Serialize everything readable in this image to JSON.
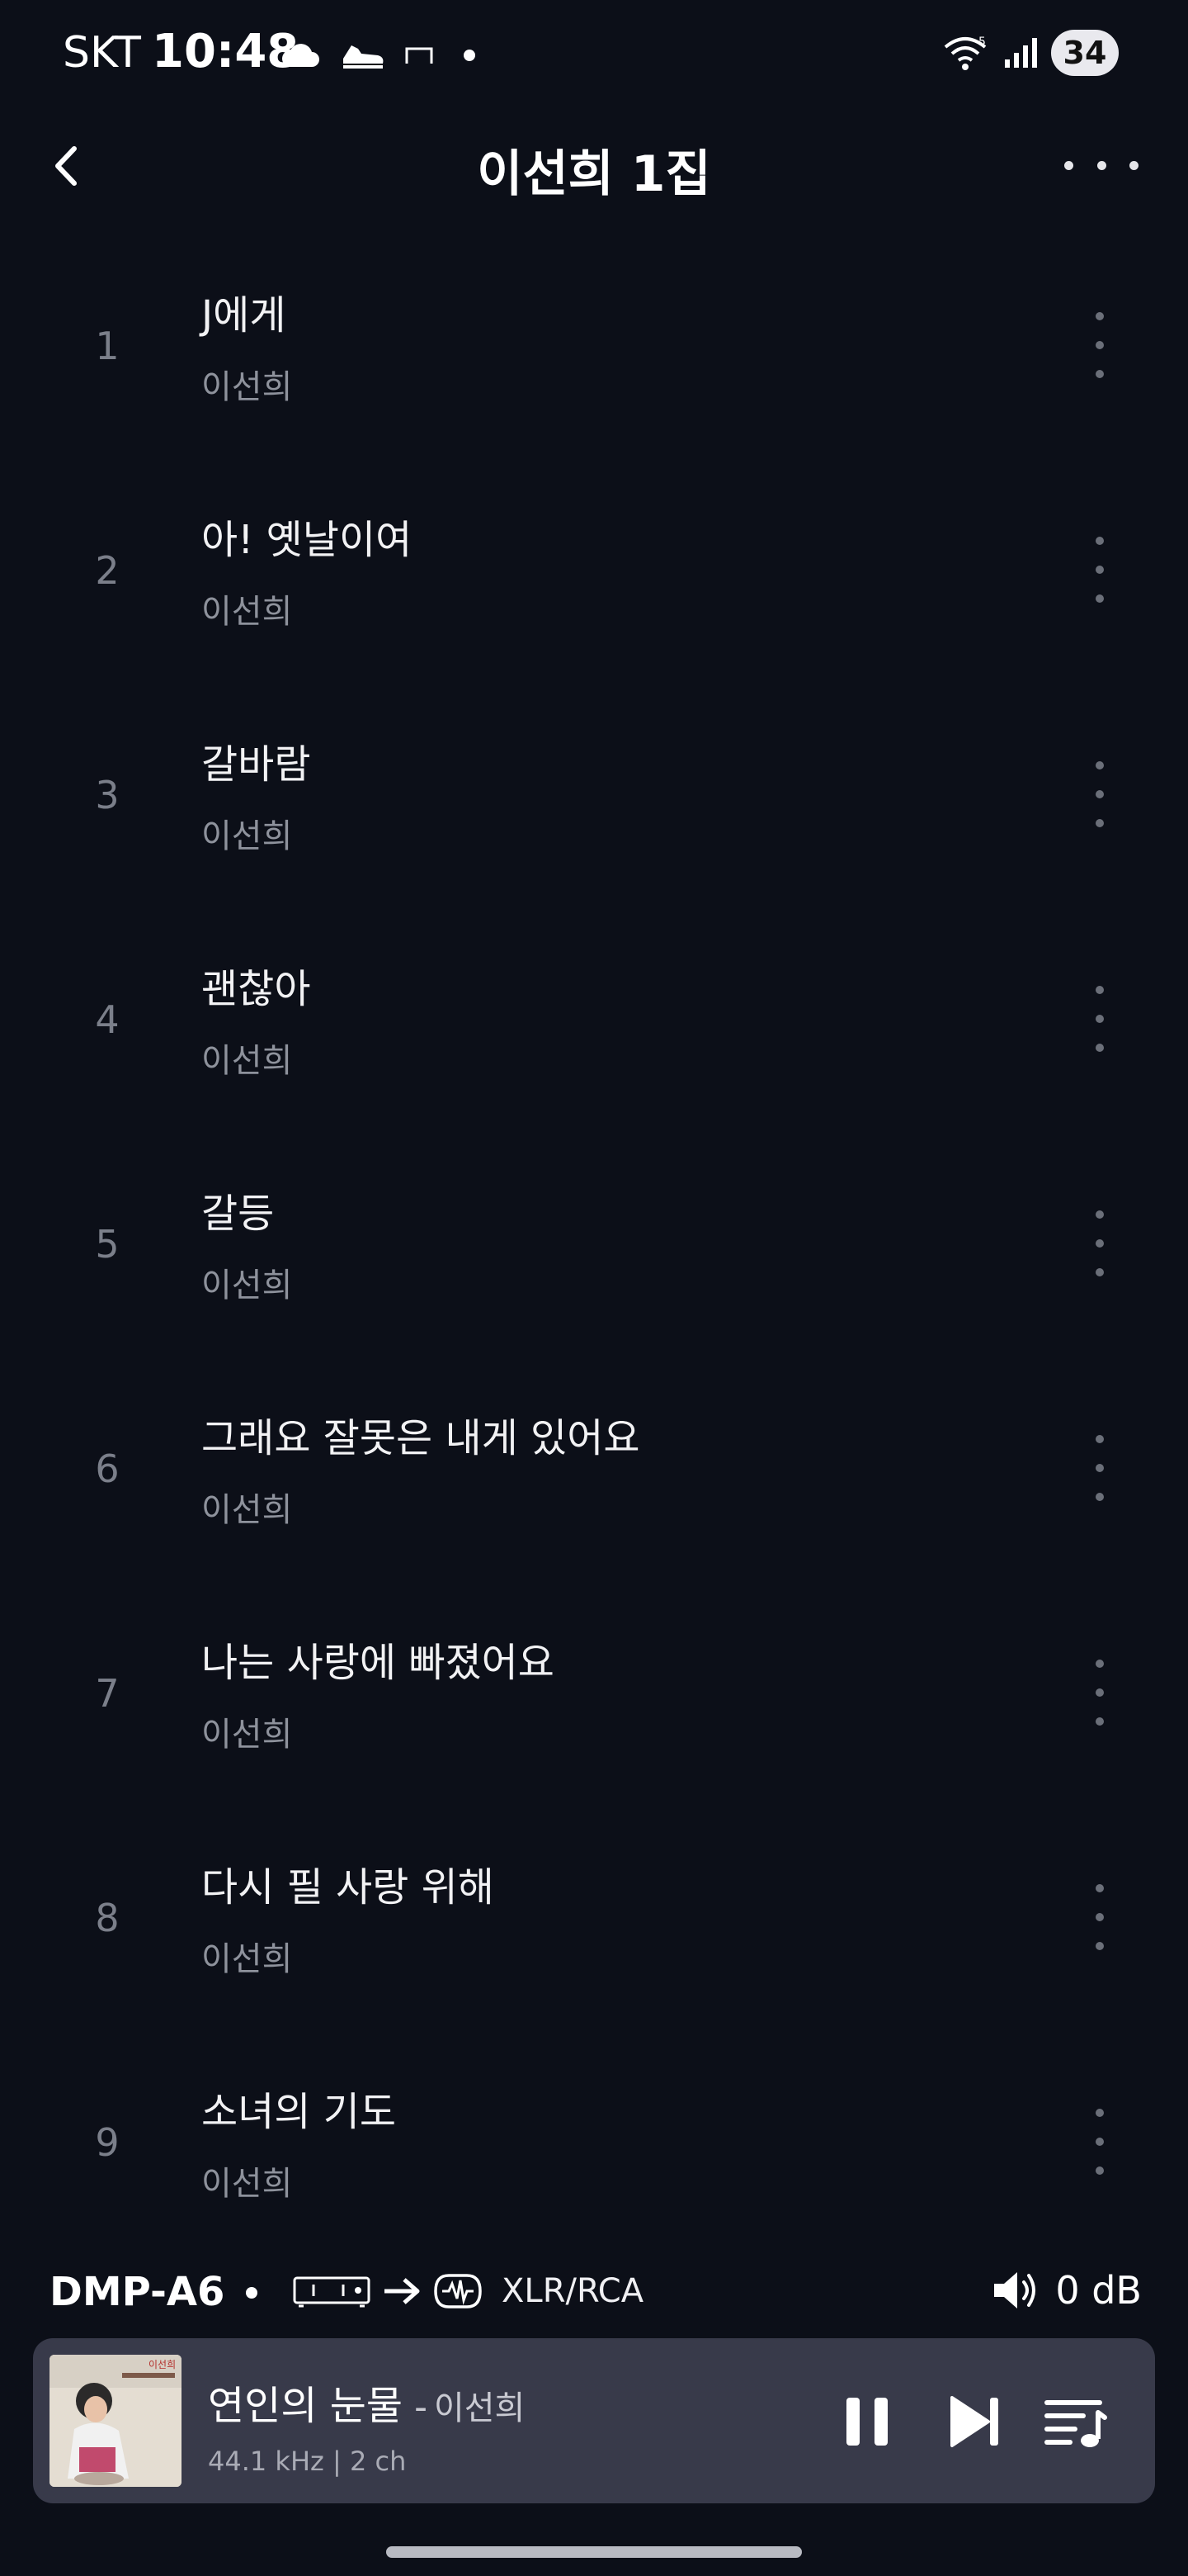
{
  "status_bar": {
    "carrier": "SKT",
    "time": "10:48",
    "battery": "34",
    "icons": [
      "cloud-icon",
      "shoe-icon",
      "rectangle-icon",
      "dot-icon",
      "wifi-icon",
      "signal-icon",
      "battery-icon"
    ]
  },
  "header": {
    "title": "이선희 1집",
    "back_icon": "chevron-left-icon",
    "more_icon": "more-horizontal-icon"
  },
  "tracks": [
    {
      "number": "1",
      "title": "J에게",
      "artist": "이선희"
    },
    {
      "number": "2",
      "title": "아! 옛날이여",
      "artist": "이선희"
    },
    {
      "number": "3",
      "title": "갈바람",
      "artist": "이선희"
    },
    {
      "number": "4",
      "title": "괜찮아",
      "artist": "이선희"
    },
    {
      "number": "5",
      "title": "갈등",
      "artist": "이선희"
    },
    {
      "number": "6",
      "title": "그래요 잘못은 내게 있어요",
      "artist": "이선희"
    },
    {
      "number": "7",
      "title": "나는 사랑에 빠졌어요",
      "artist": "이선희"
    },
    {
      "number": "8",
      "title": "다시 필 사랑 위해",
      "artist": "이선희"
    },
    {
      "number": "9",
      "title": "소녀의 기도",
      "artist": "이선희"
    }
  ],
  "output": {
    "device": "DMP-A6",
    "output_label": "XLR/RCA",
    "volume": "0 dB"
  },
  "now_playing": {
    "title": "연인의 눈물",
    "separator": "-",
    "artist": "이선희",
    "format": "44.1 kHz | 2 ch"
  },
  "colors": {
    "background": "#0c0f18",
    "player_background": "#383a4a",
    "track_number": "#7b7f8a",
    "secondary_text": "#8e929c"
  }
}
